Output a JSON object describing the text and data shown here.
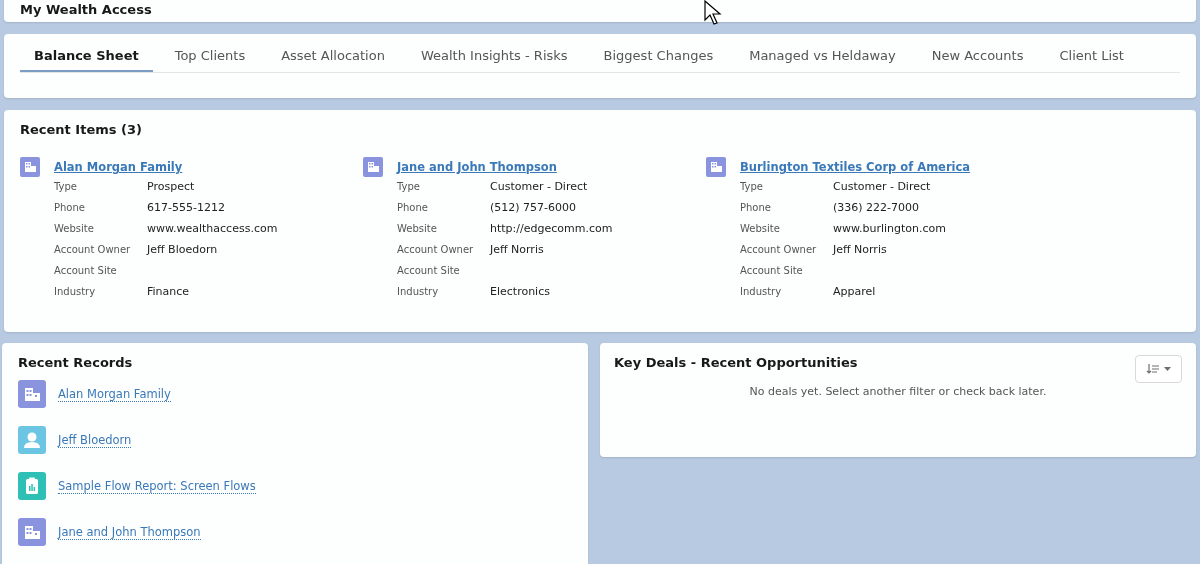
{
  "header": {
    "title": "My Wealth Access"
  },
  "tabs": [
    {
      "label": "Balance Sheet",
      "selected": true
    },
    {
      "label": "Top Clients",
      "selected": false
    },
    {
      "label": "Asset Allocation",
      "selected": false
    },
    {
      "label": "Wealth Insights - Risks",
      "selected": false
    },
    {
      "label": "Biggest Changes",
      "selected": false
    },
    {
      "label": "Managed vs Heldaway",
      "selected": false
    },
    {
      "label": "New Accounts",
      "selected": false
    },
    {
      "label": "Client List",
      "selected": false
    }
  ],
  "recent_items": {
    "title": "Recent Items (3)",
    "items": [
      {
        "name": "Alan Morgan Family",
        "fields": [
          {
            "label": "Type",
            "value": "Prospect"
          },
          {
            "label": "Phone",
            "value": "617-555-1212"
          },
          {
            "label": "Website",
            "value": "www.wealthaccess.com"
          },
          {
            "label": "Account Owner",
            "value": "Jeff Bloedorn"
          },
          {
            "label": "Account Site"
          },
          {
            "label": "Industry",
            "value": "Finance"
          }
        ]
      },
      {
        "name": "Jane and John Thompson",
        "fields": [
          {
            "label": "Type",
            "value": "Customer - Direct"
          },
          {
            "label": "Phone",
            "value": "(512) 757-6000"
          },
          {
            "label": "Website",
            "value": "http://edgecomm.com"
          },
          {
            "label": "Account Owner",
            "value": "Jeff Norris"
          },
          {
            "label": "Account Site"
          },
          {
            "label": "Industry",
            "value": "Electronics"
          }
        ]
      },
      {
        "name": "Burlington Textiles Corp of America",
        "fields": [
          {
            "label": "Type",
            "value": "Customer - Direct"
          },
          {
            "label": "Phone",
            "value": "(336) 222-7000"
          },
          {
            "label": "Website",
            "value": "www.burlington.com"
          },
          {
            "label": "Account Owner",
            "value": "Jeff Norris"
          },
          {
            "label": "Account Site"
          },
          {
            "label": "Industry",
            "value": "Apparel"
          }
        ]
      }
    ]
  },
  "recent_records": {
    "title": "Recent Records",
    "items": [
      {
        "kind": "account",
        "name": "Alan Morgan Family"
      },
      {
        "kind": "contact",
        "name": "Jeff Bloedorn"
      },
      {
        "kind": "report",
        "name": "Sample Flow Report: Screen Flows"
      },
      {
        "kind": "account",
        "name": "Jane and John Thompson"
      }
    ]
  },
  "key_deals": {
    "title": "Key Deals - Recent Opportunities",
    "message": "No deals yet. Select another filter or check back later."
  }
}
